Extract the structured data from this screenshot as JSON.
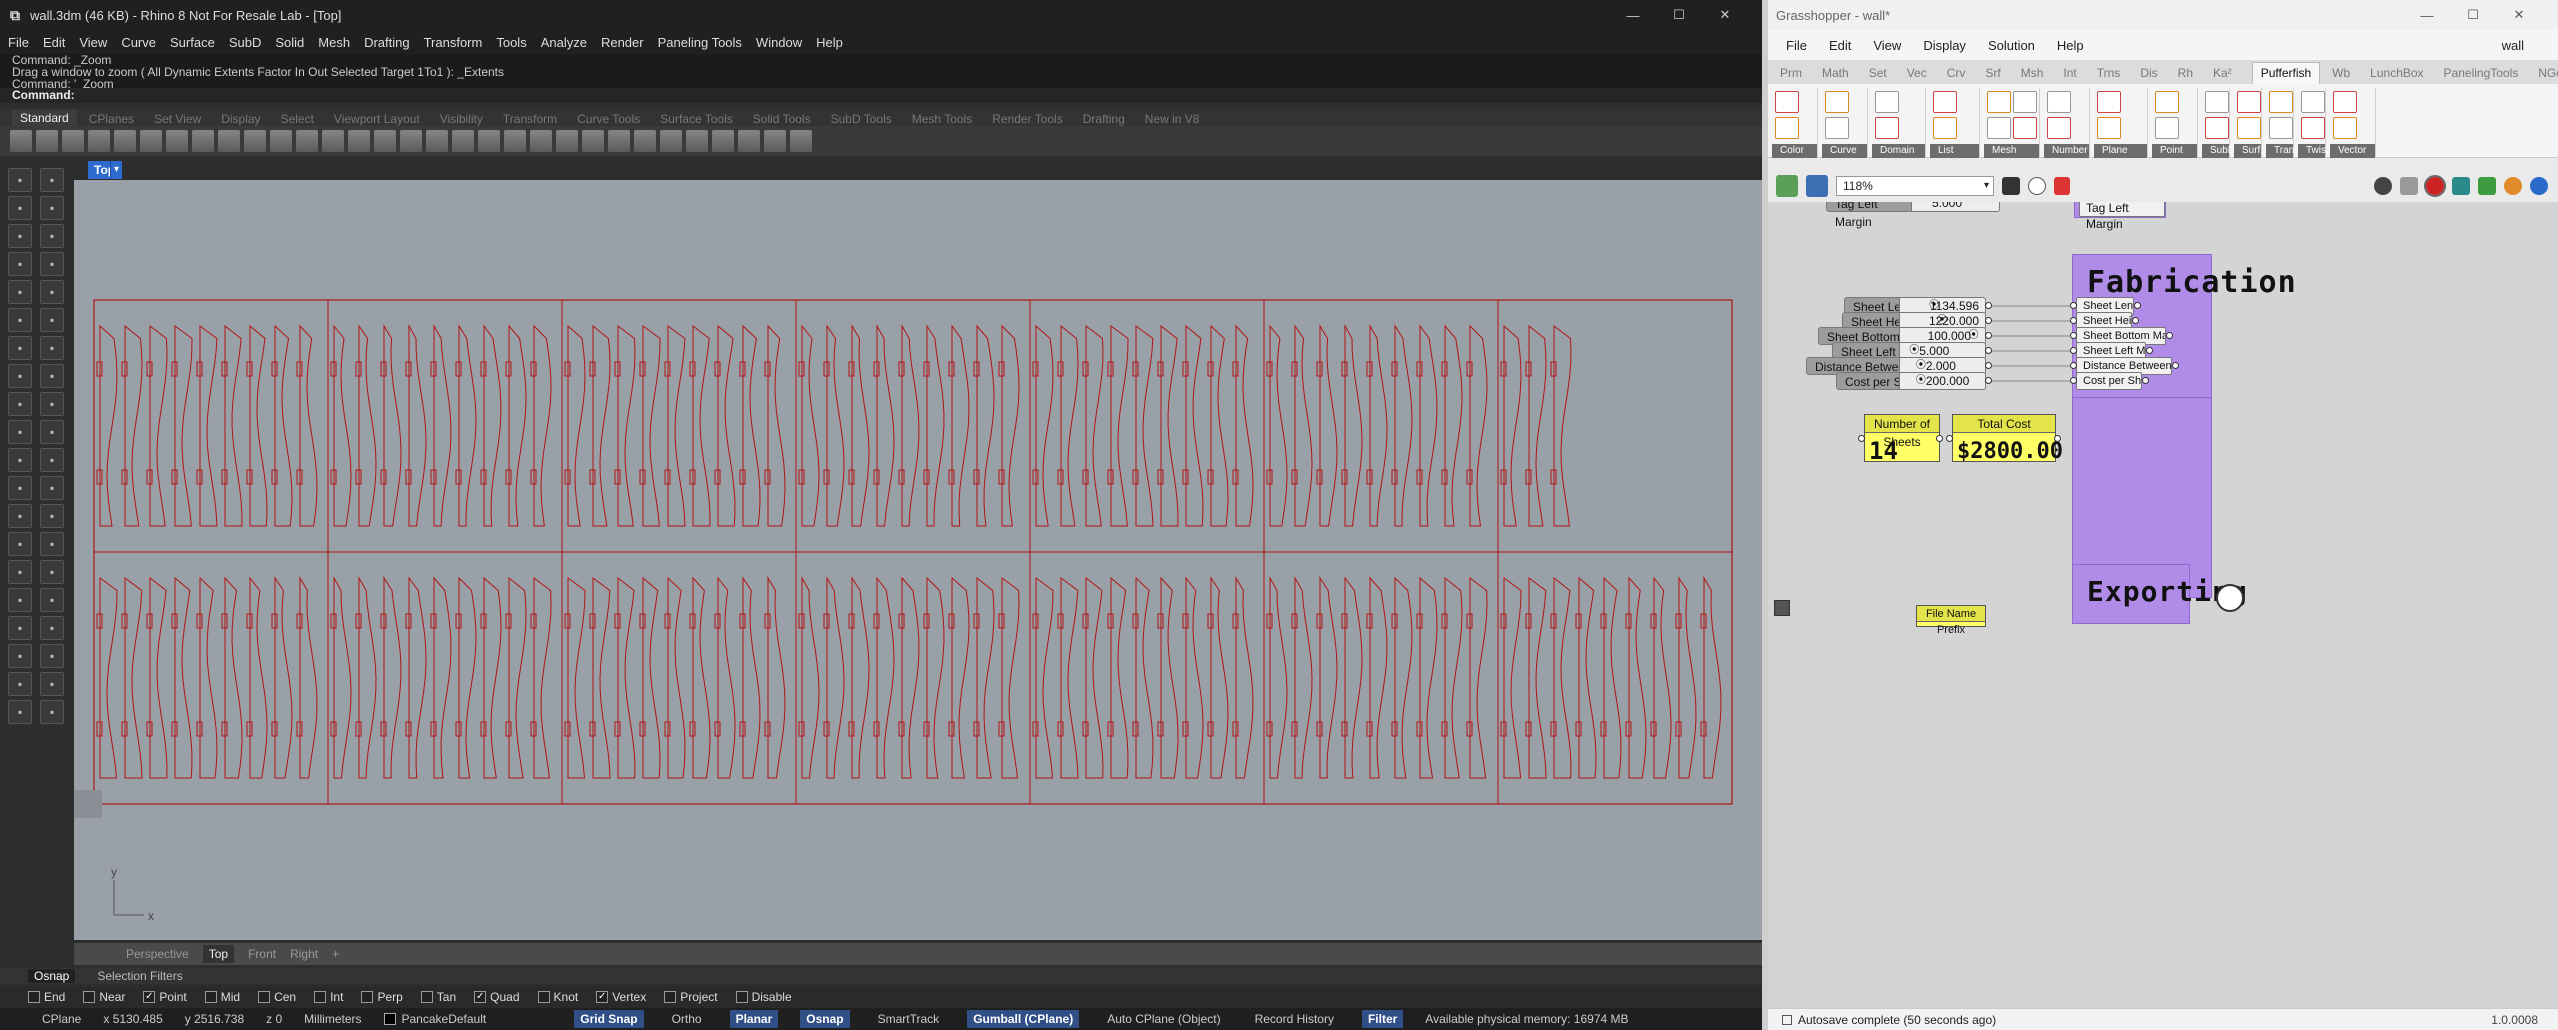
{
  "rhino": {
    "title": "wall.3dm (46 KB) - Rhino 8 Not For Resale Lab - [Top]",
    "menu": [
      "File",
      "Edit",
      "View",
      "Curve",
      "Surface",
      "SubD",
      "Solid",
      "Mesh",
      "Drafting",
      "Transform",
      "Tools",
      "Analyze",
      "Render",
      "Paneling Tools",
      "Window",
      "Help"
    ],
    "command_history": [
      "Command: _Zoom",
      "Drag a window to zoom ( All  Dynamic  Extents  Factor  In  Out  Selected  Target  1To1 ): _Extents",
      "Command: '_Zoom"
    ],
    "command_prompt": "Command:",
    "toolbar_tabs": [
      "Standard",
      "CPlanes",
      "Set View",
      "Display",
      "Select",
      "Viewport Layout",
      "Visibility",
      "Transform",
      "Curve Tools",
      "Surface Tools",
      "Solid Tools",
      "SubD Tools",
      "Mesh Tools",
      "Render Tools",
      "Drafting",
      "New in V8"
    ],
    "active_toolbar_tab": "Standard",
    "viewport_tab": "Top",
    "view_tabs": [
      "Perspective",
      "Top",
      "Front",
      "Right"
    ],
    "active_view": "Top",
    "osnap_tabs": [
      "Osnap",
      "Selection Filters"
    ],
    "snaps": [
      {
        "label": "End",
        "checked": false
      },
      {
        "label": "Near",
        "checked": false
      },
      {
        "label": "Point",
        "checked": true
      },
      {
        "label": "Mid",
        "checked": false
      },
      {
        "label": "Cen",
        "checked": false
      },
      {
        "label": "Int",
        "checked": false
      },
      {
        "label": "Perp",
        "checked": false
      },
      {
        "label": "Tan",
        "checked": false
      },
      {
        "label": "Quad",
        "checked": true
      },
      {
        "label": "Knot",
        "checked": false
      },
      {
        "label": "Vertex",
        "checked": true
      },
      {
        "label": "Project",
        "checked": false
      },
      {
        "label": "Disable",
        "checked": false
      }
    ],
    "status": {
      "cplane": "CPlane",
      "x": "x 5130.485",
      "y": "y 2516.738",
      "z": "z 0",
      "units": "Millimeters",
      "layer": "PancakeDefault",
      "grid_snap": "Grid Snap",
      "ortho": "Ortho",
      "planar": "Planar",
      "osnap": "Osnap",
      "smarttrack": "SmartTrack",
      "gumball": "Gumball (CPlane)",
      "autocplane": "Auto CPlane (Object)",
      "record_history": "Record History",
      "filter": "Filter",
      "memory": "Available physical memory: 16974 MB"
    },
    "axis_labels": {
      "y": "y",
      "x": "x"
    },
    "curve_color": "#b01515",
    "sheets": {
      "rows": 2,
      "cols": 7
    }
  },
  "gh": {
    "title": "Grasshopper - wall*",
    "menu": [
      "File",
      "Edit",
      "View",
      "Display",
      "Solution",
      "Help"
    ],
    "menu_right": "wall",
    "tabs": [
      "Prm",
      "Math",
      "Set",
      "Vec",
      "Crv",
      "Srf",
      "Msh",
      "Int",
      "Trns",
      "Dis",
      "Rh",
      "Ka²",
      "Pufferfish",
      "Wb",
      "LunchBox",
      "PanelingTools",
      "NGon",
      "L"
    ],
    "active_tab": "Pufferfish",
    "ribbon_groups": [
      "Color",
      "Curve",
      "Domain",
      "List",
      "Mesh",
      "Number",
      "Plane",
      "Point",
      "SubD",
      "Surf...",
      "Tran...",
      "Twis...",
      "Vector"
    ],
    "zoom": "118%",
    "partial_labels": {
      "top_slider": "Tag Left Margin",
      "top_slider_value": "5.000",
      "top_group_input": "Tag Left Margin"
    },
    "fabrication_title": "Fabrication",
    "exporting_title": "Exporting",
    "sliders": [
      {
        "name": "Sheet Length",
        "value": "1134.596"
      },
      {
        "name": "Sheet Height",
        "value": "1220.000"
      },
      {
        "name": "Sheet Bottom Margin",
        "value": "100.000"
      },
      {
        "name": "Sheet Left Margin",
        "value": "5.000"
      },
      {
        "name": "Distance Between Slices",
        "value": "2.000"
      },
      {
        "name": "Cost per Sheet",
        "value": "200.000"
      }
    ],
    "panels": [
      {
        "header": "Number of Sheets",
        "value": "14"
      },
      {
        "header": "Total Cost",
        "value": "$2800.00"
      }
    ],
    "file_prefix_label": "File Name Prefix",
    "status": "Autosave complete (50 seconds ago)",
    "version": "1.0.0008"
  }
}
